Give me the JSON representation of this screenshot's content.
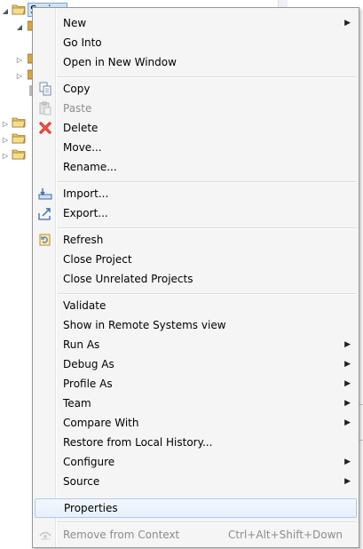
{
  "tree": {
    "top_label": "Spring"
  },
  "menu": {
    "items": [
      {
        "label": "New",
        "submenu": true,
        "icon": ""
      },
      {
        "label": "Go Into",
        "icon": ""
      },
      {
        "label": "Open in New Window",
        "icon": ""
      },
      {
        "label": "Copy",
        "icon": "copy-icon"
      },
      {
        "label": "Paste",
        "icon": "paste-icon",
        "disabled": true
      },
      {
        "label": "Delete",
        "icon": "delete-icon"
      },
      {
        "label": "Move...",
        "icon": ""
      },
      {
        "label": "Rename...",
        "icon": ""
      },
      {
        "label": "Import...",
        "icon": "import-icon"
      },
      {
        "label": "Export...",
        "icon": "export-icon"
      },
      {
        "label": "Refresh",
        "icon": "refresh-icon"
      },
      {
        "label": "Close Project",
        "icon": ""
      },
      {
        "label": "Close Unrelated Projects",
        "icon": ""
      },
      {
        "label": "Validate",
        "icon": ""
      },
      {
        "label": "Show in Remote Systems view",
        "icon": ""
      },
      {
        "label": "Run As",
        "submenu": true
      },
      {
        "label": "Debug As",
        "submenu": true
      },
      {
        "label": "Profile As",
        "submenu": true
      },
      {
        "label": "Team",
        "submenu": true
      },
      {
        "label": "Compare With",
        "submenu": true
      },
      {
        "label": "Restore from Local History...",
        "icon": ""
      },
      {
        "label": "Configure",
        "submenu": true
      },
      {
        "label": "Source",
        "submenu": true
      },
      {
        "label": "Properties",
        "hovered": true
      },
      {
        "label": "Remove from Context",
        "icon": "remove-context-icon",
        "disabled": true,
        "shortcut": "Ctrl+Alt+Shift+Down"
      }
    ]
  },
  "colors": {
    "menu_bg": "#f5f5f5",
    "hover_border": "#aecbef",
    "disabled_text": "#8d8d8d",
    "delete_red": "#d9261c"
  }
}
